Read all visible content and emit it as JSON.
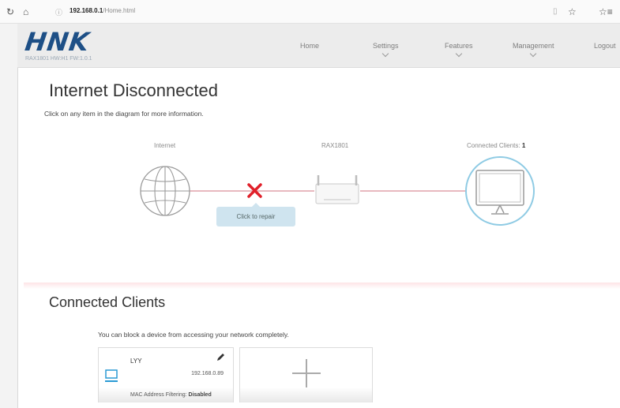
{
  "browser": {
    "url_host": "192.168.0.1",
    "url_path": "/Home.html",
    "icons": [
      "refresh-icon",
      "home-icon",
      "info-icon",
      "reading-view-icon",
      "favorite-star-icon",
      "favorites-list-icon"
    ]
  },
  "header": {
    "logo": "HNK",
    "hw_info": "RAX1801 HW:H1 FW:1.0.1",
    "nav": {
      "home": "Home",
      "settings": "Settings",
      "features": "Features",
      "management": "Management",
      "logout": "Logout"
    }
  },
  "main": {
    "title": "Internet Disconnected",
    "subtitle": "Click on any item in the diagram for more information.",
    "diagram": {
      "internet_label": "Internet",
      "router_label": "RAX1801",
      "clients_label": "Connected Clients:",
      "clients_count": "1",
      "repair_label": "Click to repair",
      "colors": {
        "link": "#e8b9bf",
        "error": "#e0202a",
        "client_ring": "#8fcbe4"
      }
    }
  },
  "clients_section": {
    "title": "Connected Clients",
    "block_text": "You can block a device from accessing your network completely.",
    "cards": [
      {
        "name": "LYY",
        "ip": "192.168.0.89",
        "mac_filter_label": "MAC Address Filtering:",
        "mac_filter_value": "Disabled"
      }
    ]
  }
}
